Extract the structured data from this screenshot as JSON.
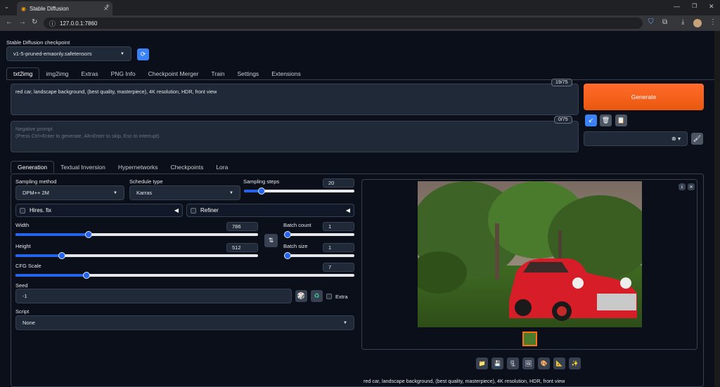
{
  "browser": {
    "tab_title": "Stable Diffusion",
    "url": "127.0.0.1:7860"
  },
  "checkpoint": {
    "label": "Stable Diffusion checkpoint",
    "value": "v1-5-pruned-emaonly.safetensors"
  },
  "main_tabs": [
    "txt2img",
    "img2img",
    "Extras",
    "PNG Info",
    "Checkpoint Merger",
    "Train",
    "Settings",
    "Extensions"
  ],
  "prompt": {
    "text": "red car, landscape background, (best quality, masterpiece), 4K resolution, HDR, front view",
    "token_count": "19/75"
  },
  "negative_prompt": {
    "placeholder_line1": "Negative prompt",
    "placeholder_line2": "(Press Ctrl+Enter to generate, Alt+Enter to skip, Esc to interrupt)",
    "token_count": "0/75"
  },
  "generate_label": "Generate",
  "sub_tabs": [
    "Generation",
    "Textual Inversion",
    "Hypernetworks",
    "Checkpoints",
    "Lora"
  ],
  "sampling_method": {
    "label": "Sampling method",
    "value": "DPM++ 2M"
  },
  "schedule_type": {
    "label": "Schedule type",
    "value": "Karras"
  },
  "sampling_steps": {
    "label": "Sampling steps",
    "value": "20",
    "fraction": 0.16
  },
  "hires_fix_label": "Hires. fix",
  "refiner_label": "Refiner",
  "width": {
    "label": "Width",
    "value": "786",
    "fraction": 0.3
  },
  "height": {
    "label": "Height",
    "value": "512",
    "fraction": 0.19
  },
  "batch_count": {
    "label": "Batch count",
    "value": "1",
    "fraction": 0.0
  },
  "batch_size": {
    "label": "Batch size",
    "value": "1",
    "fraction": 0.0
  },
  "cfg_scale": {
    "label": "CFG Scale",
    "value": "7",
    "fraction": 0.21
  },
  "seed": {
    "label": "Seed",
    "value": "-1",
    "extra_label": "Extra"
  },
  "script": {
    "label": "Script",
    "value": "None"
  },
  "output_caption": "red car, landscape background, (best quality, masterpiece), 4K resolution, HDR, front view",
  "colors": {
    "accent": "#2563eb",
    "generate": "#f36b1c",
    "background": "#0b0f19"
  }
}
